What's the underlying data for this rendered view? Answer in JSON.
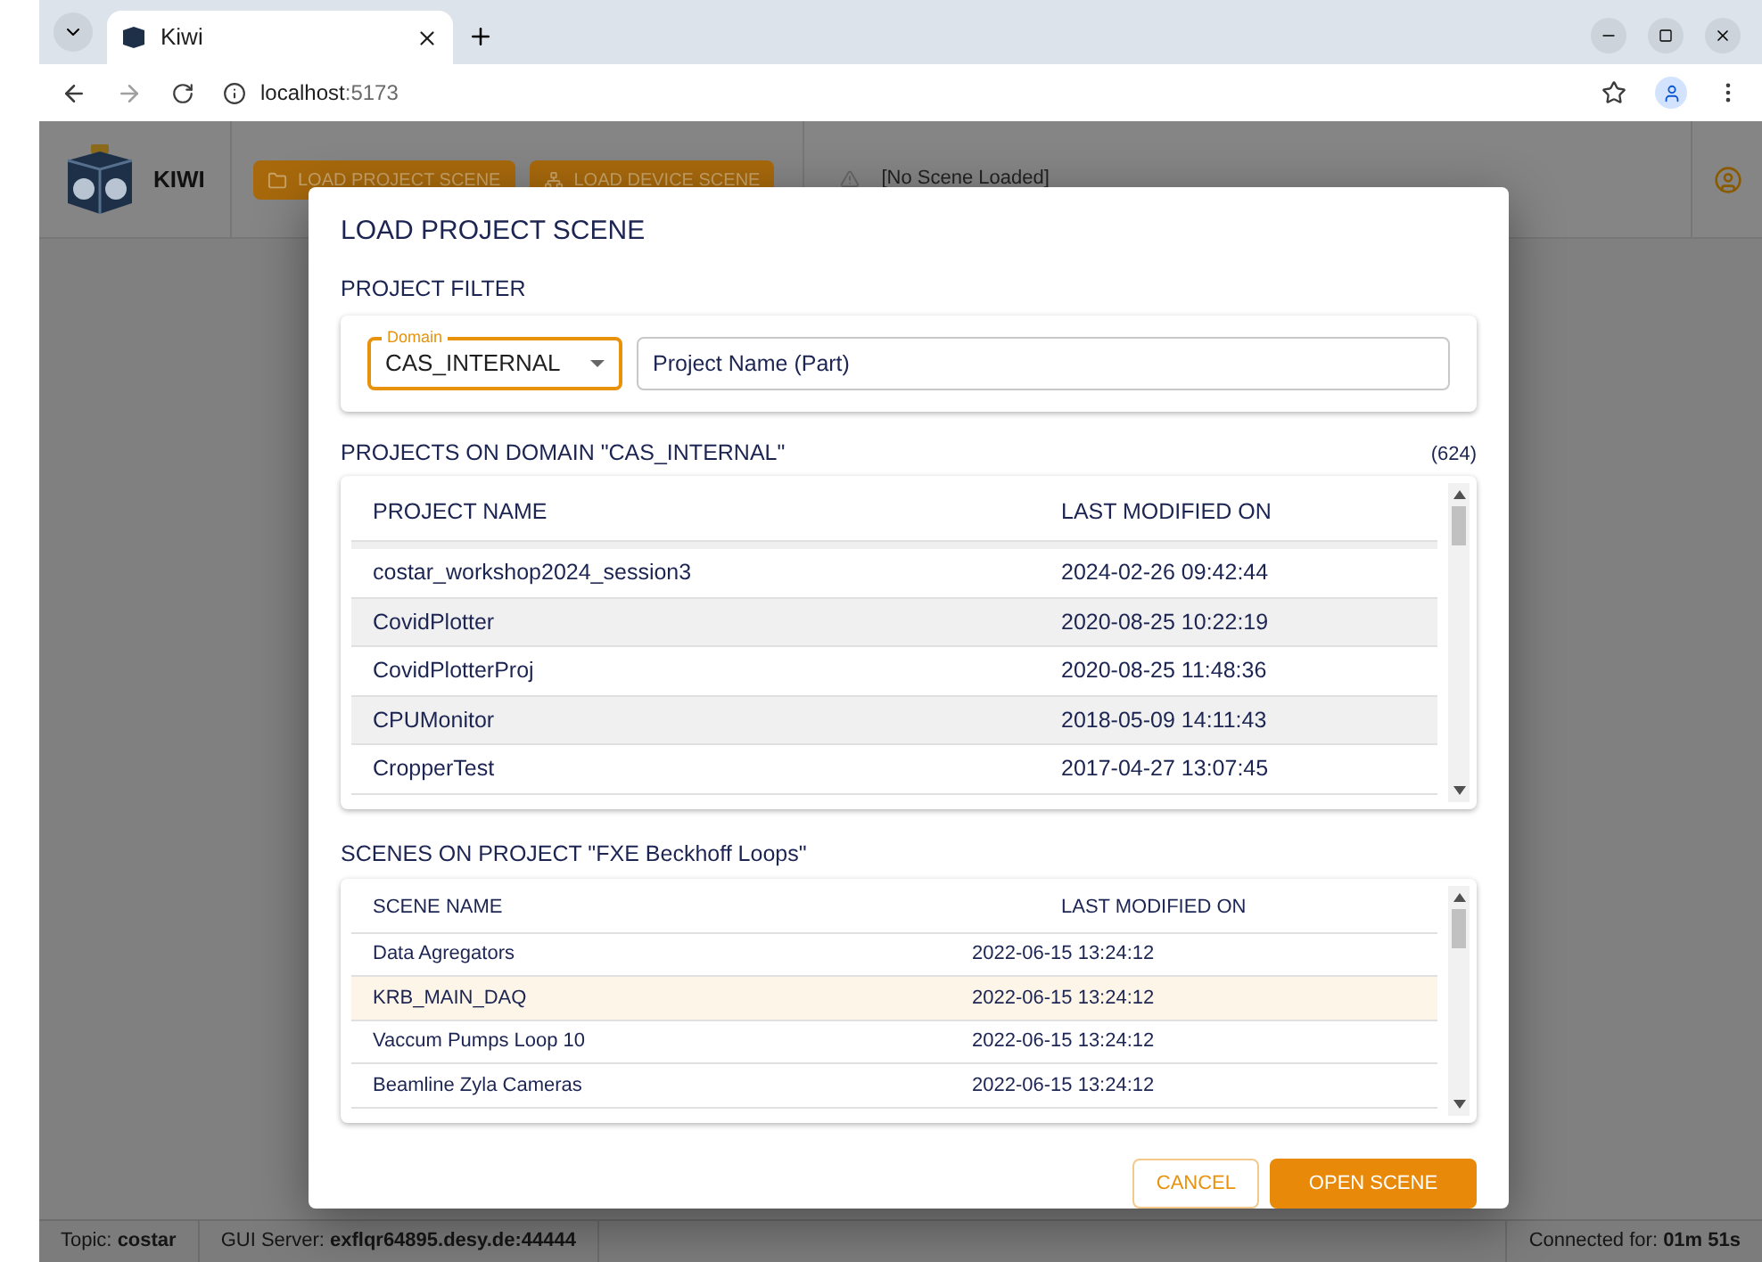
{
  "browser": {
    "tab_title": "Kiwi",
    "url_host": "localhost",
    "url_port": ":5173"
  },
  "app": {
    "brand": "KIWI",
    "header_buttons": [
      "LOAD PROJECT SCENE",
      "LOAD DEVICE SCENE"
    ],
    "scene_status": "[No Scene Loaded]"
  },
  "dialog": {
    "title": "LOAD PROJECT SCENE",
    "filter_heading": "PROJECT FILTER",
    "domain": {
      "label": "Domain",
      "value": "CAS_INTERNAL"
    },
    "project_name": {
      "placeholder": "Project Name (Part)"
    },
    "projects_heading": "PROJECTS ON DOMAIN \"CAS_INTERNAL\"",
    "projects_count": "(624)",
    "projects": {
      "columns": [
        "PROJECT NAME",
        "LAST MODIFIED ON"
      ],
      "rows": [
        {
          "name": "costar_workshop2024_session3",
          "modified": "2024-02-26 09:42:44",
          "selected": false
        },
        {
          "name": "CovidPlotter",
          "modified": "2020-08-25 10:22:19",
          "selected": false
        },
        {
          "name": "CovidPlotterProj",
          "modified": "2020-08-25 11:48:36",
          "selected": false
        },
        {
          "name": "CPUMonitor",
          "modified": "2018-05-09 14:11:43",
          "selected": false
        },
        {
          "name": "CropperTest",
          "modified": "2017-04-27 13:07:45",
          "selected": false
        }
      ]
    },
    "scenes_heading": "SCENES ON PROJECT \"FXE Beckhoff Loops\"",
    "scenes": {
      "columns": [
        "SCENE NAME",
        "LAST MODIFIED ON"
      ],
      "rows": [
        {
          "name": "Data Agregators",
          "modified": "2022-06-15 13:24:12",
          "selected": false
        },
        {
          "name": "KRB_MAIN_DAQ",
          "modified": "2022-06-15 13:24:12",
          "selected": true
        },
        {
          "name": "Vaccum Pumps Loop 10",
          "modified": "2022-06-15 13:24:12",
          "selected": false
        },
        {
          "name": "Beamline Zyla Cameras",
          "modified": "2022-06-15 13:24:12",
          "selected": false
        }
      ]
    },
    "buttons": [
      "CANCEL",
      "OPEN SCENE"
    ]
  },
  "status_bar": {
    "topic_label": "Topic:",
    "topic": "costar",
    "server_label": "GUI Server:",
    "server": "exflqr64895.desy.de:44444",
    "connected_label": "Connected for:",
    "connected": "01m 51s"
  }
}
